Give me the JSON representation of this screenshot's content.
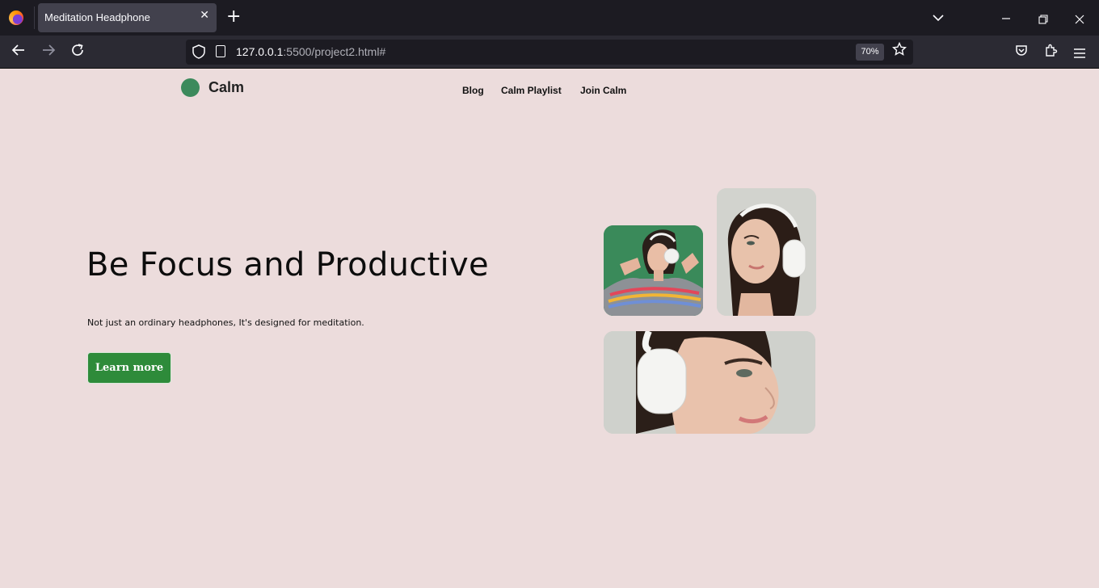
{
  "browser": {
    "tab_title": "Meditation Headphone",
    "tab_close": "✕",
    "new_tab": "+",
    "url_host": "127.0.0.1",
    "url_rest": ":5500/project2.html#",
    "zoom": "70%",
    "icons": [
      "firefox-icon",
      "back-icon",
      "forward-icon",
      "reload-icon",
      "shield-icon",
      "page-icon",
      "star-icon",
      "pocket-icon",
      "extensions-icon",
      "menu-icon",
      "list-tabs-icon",
      "minimize-icon",
      "restore-icon",
      "close-icon"
    ]
  },
  "site": {
    "logo_text": "Calm",
    "logo_color": "#3c8a5c",
    "nav": [
      "Blog",
      "Calm Playlist",
      "Join Calm"
    ],
    "hero_title": "Be Focus and Productive",
    "hero_subtitle": "Not just an ordinary headphones, It's designed for meditation.",
    "cta_label": "Learn more",
    "cta_color": "#2e8b3a",
    "background": "#ecdcdc"
  }
}
